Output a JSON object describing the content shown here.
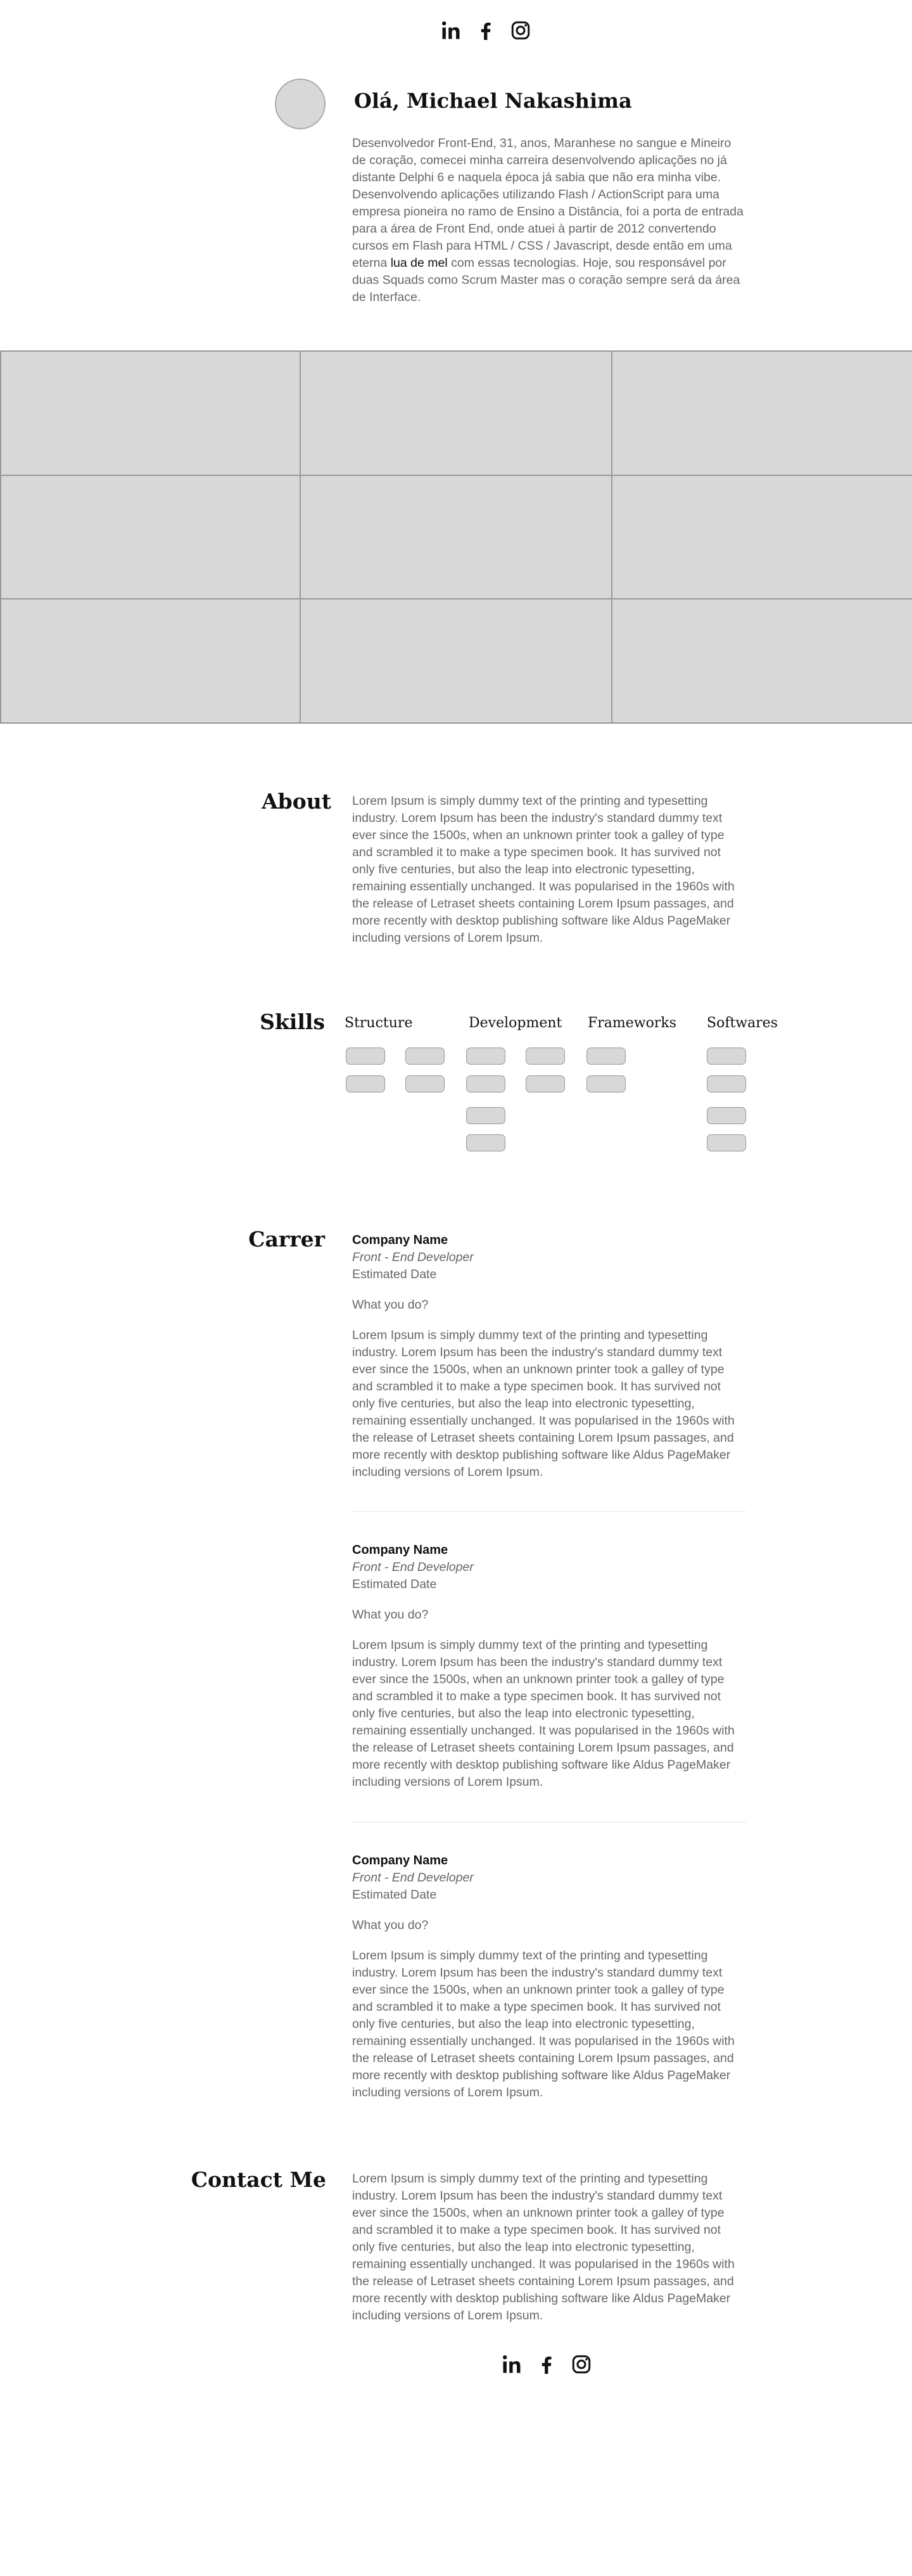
{
  "header": {
    "social": [
      {
        "name": "linkedin",
        "icon": "linkedin-icon"
      },
      {
        "name": "facebook",
        "icon": "facebook-icon"
      },
      {
        "name": "instagram",
        "icon": "instagram-icon"
      }
    ]
  },
  "intro": {
    "greeting": "Olá, Michael Nakashima",
    "bio_before": "Desenvolvedor Front-End, 31, anos, Maranhese no sangue e Mineiro de coração, comecei minha carreira desenvolvendo aplicações no já distante Delphi 6 e naquela época já sabia que não era minha vibe. Desenvolvendo aplicações utilizando Flash / ActionScript para uma empresa pioneira no ramo de Ensino a Distância, foi a porta de entrada para a área de Front End, onde atuei à partir de 2012 convertendo cursos em Flash para HTML / CSS / Javascript, desde então em uma eterna ",
    "bio_highlight": "lua de mel",
    "bio_after": " com essas tecnologias. Hoje, sou responsável por duas Squads como Scrum Master mas o coração sempre será da área de Interface."
  },
  "about": {
    "title": "About",
    "text": "Lorem Ipsum is simply dummy text of the printing and typesetting industry. Lorem Ipsum has been the industry's standard dummy text ever since the 1500s, when an unknown printer took a galley of type and scrambled it to make a type specimen book. It has survived not only five centuries, but also the leap into electronic typesetting, remaining essentially unchanged. It was popularised in the 1960s with the release of Letraset sheets containing Lorem Ipsum passages, and more recently with desktop publishing software like Aldus  PageMaker including versions of Lorem Ipsum."
  },
  "skills": {
    "title": "Skills",
    "columns": [
      {
        "label": "Structure",
        "pills": 4
      },
      {
        "label": "Development",
        "pills": 6
      },
      {
        "label": "Frameworks",
        "pills": 2
      },
      {
        "label": "Softwares",
        "pills": 4
      }
    ]
  },
  "career": {
    "title": "Carrer",
    "jobs": [
      {
        "company": "Company Name",
        "role": "Front - End Developer",
        "date": "Estimated Date",
        "question": "What you do?",
        "text": "Lorem Ipsum is simply dummy text of the printing and typesetting industry. Lorem Ipsum has been the industry's standard dummy text ever since the 1500s, when an unknown printer took a galley of type and scrambled it to make a type specimen book. It has survived not only five centuries, but also the leap into electronic typesetting, remaining essentially unchanged. It was popularised in the 1960s with the release of Letraset sheets containing Lorem Ipsum passages, and more recently with desktop publishing software like Aldus  PageMaker including versions of Lorem Ipsum."
      },
      {
        "company": "Company Name",
        "role": "Front - End Developer",
        "date": "Estimated Date",
        "question": "What you do?",
        "text": "Lorem Ipsum is simply dummy text of the printing and typesetting industry. Lorem Ipsum has been the industry's standard dummy text ever since the 1500s, when an unknown printer took a galley of type and scrambled it to make a type specimen book. It has survived not only five centuries, but also the leap into electronic typesetting, remaining essentially unchanged. It was popularised in the 1960s with the release of Letraset sheets containing Lorem Ipsum passages, and more recently with desktop publishing software like Aldus  PageMaker including versions of Lorem Ipsum."
      },
      {
        "company": "Company Name",
        "role": "Front - End Developer",
        "date": "Estimated Date",
        "question": "What you do?",
        "text": "Lorem Ipsum is simply dummy text of the printing and typesetting industry. Lorem Ipsum has been the industry's standard dummy text ever since the 1500s, when an unknown printer took a galley of type and scrambled it to make a type specimen book. It has survived not only five centuries, but also the leap into electronic typesetting, remaining essentially unchanged. It was popularised in the 1960s with the release of Letraset sheets containing Lorem Ipsum passages, and more recently with desktop publishing software like Aldus  PageMaker including versions of Lorem Ipsum."
      }
    ]
  },
  "contact": {
    "title": "Contact Me",
    "text": "Lorem Ipsum is simply dummy text of the printing and typesetting industry. Lorem Ipsum has been the industry's standard dummy text ever since the 1500s, when an unknown printer took a galley of type and scrambled it to make a type specimen book. It has survived not only five centuries, but also the leap into electronic typesetting, remaining essentially unchanged. It was popularised in the 1960s with the release of Letraset sheets containing Lorem Ipsum passages, and more recently with desktop publishing software like Aldus  PageMaker including versions of Lorem Ipsum."
  },
  "footer": {
    "social": [
      {
        "name": "linkedin",
        "icon": "linkedin-icon"
      },
      {
        "name": "facebook",
        "icon": "facebook-icon"
      },
      {
        "name": "instagram",
        "icon": "instagram-icon"
      }
    ]
  }
}
